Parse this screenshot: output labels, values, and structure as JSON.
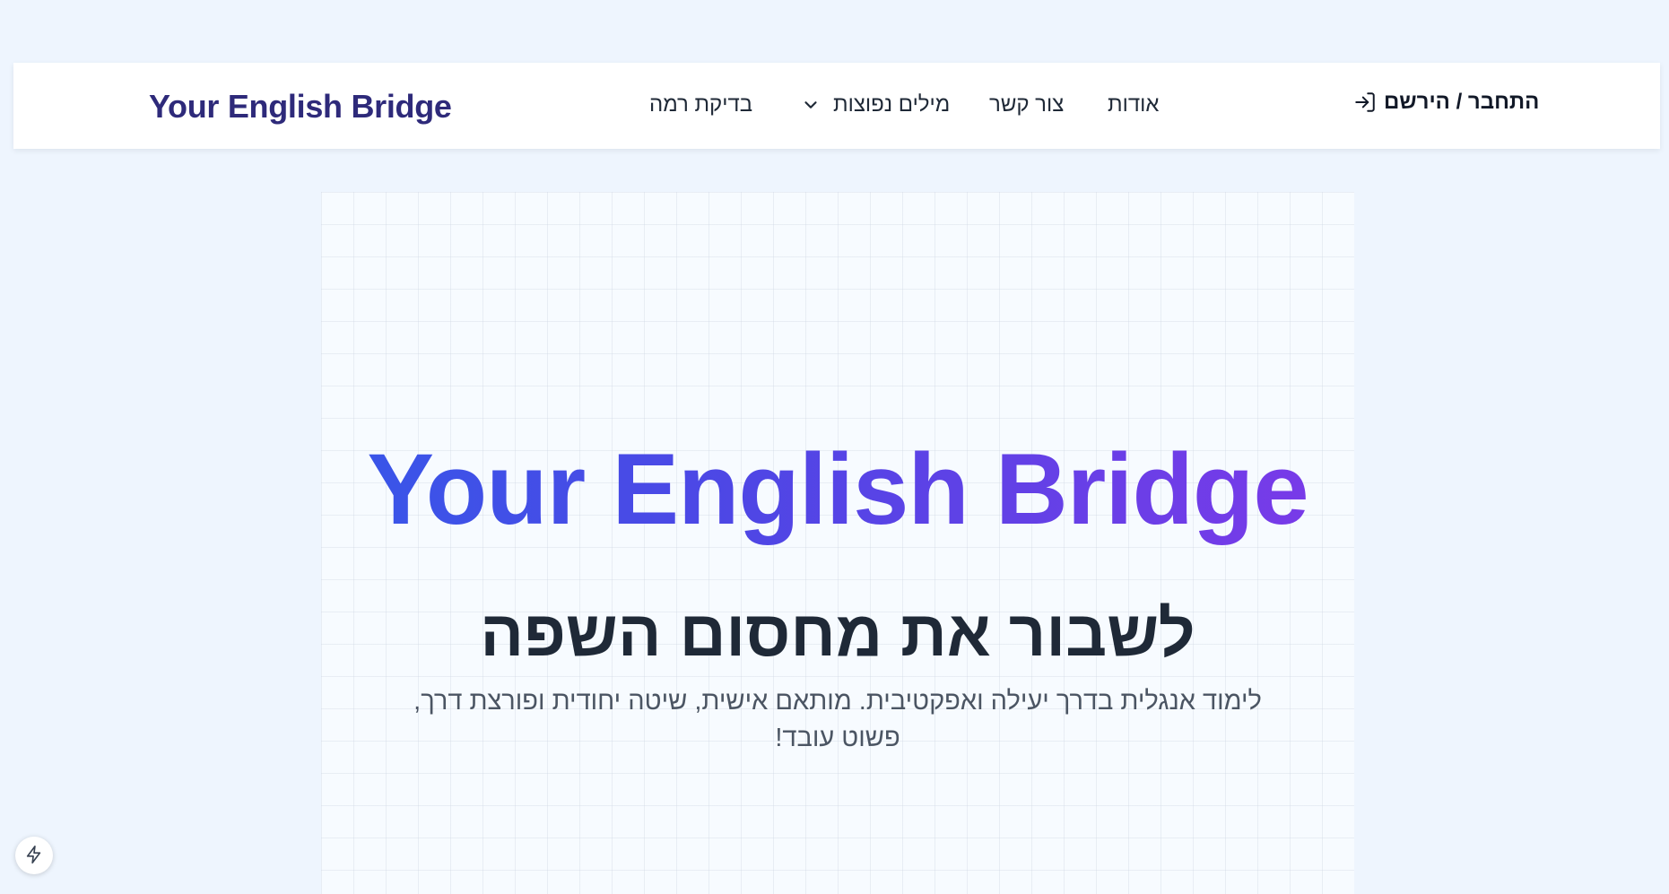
{
  "header": {
    "brand": "Your English Bridge",
    "nav": {
      "about": "אודות",
      "contact": "צור קשר",
      "common_words": "מילים נפוצות",
      "level_test": "בדיקת רמה"
    },
    "login_label": "התחבר / הירשם"
  },
  "hero": {
    "title": "Your English Bridge",
    "subtitle": "לשבור את מחסום השפה",
    "description": "לימוד אנגלית בדרך יעילה ואפקטיבית. מותאם אישית, שיטה יחודית ופורצת דרך, פשוט עובד!"
  },
  "icons": {
    "dropdown": "chevron-down-icon",
    "login": "login-arrow-icon",
    "fab": "lightning-bolt-icon"
  },
  "colors": {
    "background": "#eef5fe",
    "brand": "#2e2a7a",
    "gradient_start": "#2563eb",
    "gradient_end": "#9333ea",
    "heading": "#1f2937",
    "body_text": "#4b5563"
  }
}
